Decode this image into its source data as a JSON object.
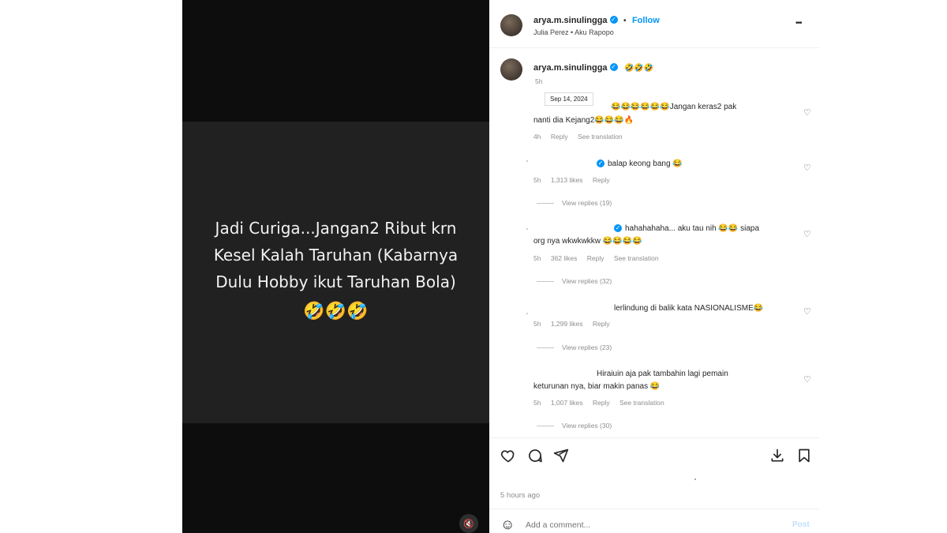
{
  "video": {
    "caption_lines": [
      "Jadi Curiga...Jangan2 Ribut krn",
      "Kesel Kalah Taruhan (Kabarnya",
      "Dulu Hobby ikut Taruhan Bola)"
    ],
    "caption_emoji": "🤣🤣🤣",
    "mute_icon": "🔇"
  },
  "header": {
    "username": "arya.m.sinulingga",
    "follow_label": "Follow",
    "audio": "Julia Perez • Aku Rapopo",
    "more": "•••"
  },
  "owner_comment": {
    "username": "arya.m.sinulingga",
    "text": "🤣🤣🤣",
    "time": "5h",
    "tooltip": "Sep 14, 2024"
  },
  "comments": [
    {
      "text1": "😂😂😂😂😂😂Jangan keras2 pak",
      "text2": "nanti dia Kejang2😂😂😂🔥",
      "time": "4h",
      "likes": "",
      "reply": "Reply",
      "translate": "See translation",
      "view_replies": ""
    },
    {
      "text1": "balap keong bang 😂",
      "text2": "",
      "time": "5h",
      "likes": "1,313 likes",
      "reply": "Reply",
      "translate": "",
      "view_replies": "View replies (19)"
    },
    {
      "text1": "hahahahaha... aku tau nih 😂😂 siapa",
      "text2": "org nya wkwkwkkw 😂😂😂😂",
      "time": "5h",
      "likes": "362 likes",
      "reply": "Reply",
      "translate": "See translation",
      "view_replies": "View replies (32)"
    },
    {
      "text1": "lerlindung di balik kata NASIONALISME😂",
      "text2": "",
      "time": "5h",
      "likes": "1,299 likes",
      "reply": "Reply",
      "translate": "",
      "view_replies": "View replies (23)"
    },
    {
      "text1": "Hiraiuin aja pak tambahin lagi pemain",
      "text2": "keturunan nya, biar makin panas 😂",
      "time": "5h",
      "likes": "1,007 likes",
      "reply": "Reply",
      "translate": "See translation",
      "view_replies": "View replies (30)"
    }
  ],
  "footer": {
    "time_ago": "5 hours ago",
    "add_comment_placeholder": "Add a comment...",
    "post_label": "Post",
    "emoji_icon": "☺"
  },
  "colors": {
    "accent": "#0095f6",
    "video_bg": "#0d0d0d",
    "video_panel": "#212121"
  }
}
